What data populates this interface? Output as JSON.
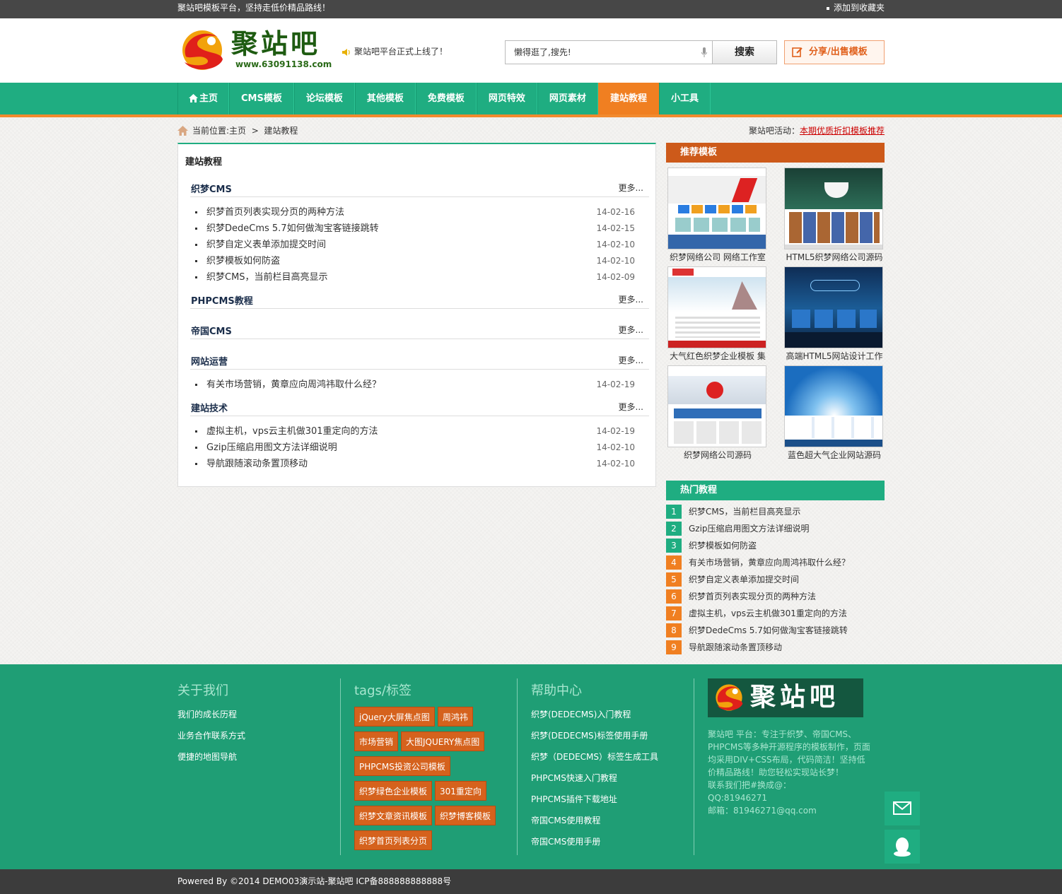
{
  "topbar": {
    "slogan": "聚站吧模板平台，坚持走低价精品路线！",
    "bookmark": "添加到收藏夹"
  },
  "header": {
    "logo_text": "聚站吧",
    "logo_url": "www.63091138.com",
    "notice": "聚站吧平台正式上线了！",
    "search_placeholder": "懒得逛了,搜先!",
    "search_button": "搜索",
    "share_button": "分享/出售模板"
  },
  "nav": [
    {
      "label": "主页",
      "active": false
    },
    {
      "label": "CMS模板",
      "active": false
    },
    {
      "label": "论坛模板",
      "active": false
    },
    {
      "label": "其他模板",
      "active": false
    },
    {
      "label": "免费模板",
      "active": false
    },
    {
      "label": "网页特效",
      "active": false
    },
    {
      "label": "网页素材",
      "active": false
    },
    {
      "label": "建站教程",
      "active": true
    },
    {
      "label": "小工具",
      "active": false
    }
  ],
  "breadcrumb": {
    "prefix": "当前位置:",
    "home": "主页",
    "sep": ">",
    "current": "建站教程",
    "activity_label": "聚站吧活动：",
    "activity_link": "本期优质折扣模板推荐"
  },
  "main": {
    "title": "建站教程",
    "more": "更多...",
    "categories": [
      {
        "name": "织梦CMS",
        "articles": [
          {
            "title": "织梦首页列表实现分页的两种方法",
            "date": "14-02-16"
          },
          {
            "title": "织梦DedeCms 5.7如何做淘宝客链接跳转",
            "date": "14-02-15"
          },
          {
            "title": "织梦自定义表单添加提交时间",
            "date": "14-02-10"
          },
          {
            "title": "织梦模板如何防盗",
            "date": "14-02-10"
          },
          {
            "title": "织梦CMS，当前栏目高亮显示",
            "date": "14-02-09"
          }
        ]
      },
      {
        "name": "PHPCMS教程",
        "articles": []
      },
      {
        "name": "帝国CMS",
        "articles": []
      },
      {
        "name": "网站运营",
        "articles": [
          {
            "title": "有关市场营销，黄章应向周鸿祎取什么经？",
            "date": "14-02-19"
          }
        ]
      },
      {
        "name": "建站技术",
        "articles": [
          {
            "title": "虚拟主机，vps云主机做301重定向的方法",
            "date": "14-02-19"
          },
          {
            "title": "Gzip压缩启用图文方法详细说明",
            "date": "14-02-10"
          },
          {
            "title": "导航跟随滚动条置顶移动",
            "date": "14-02-10"
          }
        ]
      }
    ]
  },
  "sidebar": {
    "recommend_title": "推荐模板",
    "templates": [
      {
        "caption": "织梦网络公司 网络工作室",
        "theme": "#e8eef7"
      },
      {
        "caption": "HTML5织梦网络公司源码",
        "theme": "#1c3a33"
      },
      {
        "caption": "大气红色织梦企业模板 集",
        "theme": "#dfeaf3"
      },
      {
        "caption": "高端HTML5网站设计工作",
        "theme": "#0f2d55"
      },
      {
        "caption": "织梦网络公司源码",
        "theme": "#2f6eb8"
      },
      {
        "caption": "蓝色超大气企业网站源码",
        "theme": "#1b6dbf"
      }
    ],
    "hot_title": "热门教程",
    "hot": [
      {
        "n": "1",
        "title": "织梦CMS，当前栏目高亮显示",
        "color": "g"
      },
      {
        "n": "2",
        "title": "Gzip压缩启用图文方法详细说明",
        "color": "g"
      },
      {
        "n": "3",
        "title": "织梦模板如何防盗",
        "color": "g"
      },
      {
        "n": "4",
        "title": "有关市场营销，黄章应向周鸿祎取什么经？",
        "color": "o"
      },
      {
        "n": "5",
        "title": "织梦自定义表单添加提交时间",
        "color": "o"
      },
      {
        "n": "6",
        "title": "织梦首页列表实现分页的两种方法",
        "color": "o"
      },
      {
        "n": "7",
        "title": "虚拟主机，vps云主机做301重定向的方法",
        "color": "o"
      },
      {
        "n": "8",
        "title": "织梦DedeCms 5.7如何做淘宝客链接跳转",
        "color": "o"
      },
      {
        "n": "9",
        "title": "导航跟随滚动条置顶移动",
        "color": "o"
      }
    ]
  },
  "footer": {
    "about_title": "关于我们",
    "about_links": [
      "我们的成长历程",
      "业务合作联系方式",
      "便捷的地图导航"
    ],
    "tags_title": "tags/标签",
    "tags": [
      "jQuery大屏焦点图",
      "周鸿祎",
      "市场营销",
      "大图JQUERY焦点图",
      "PHPCMS投资公司模板",
      "织梦绿色企业模板",
      "301重定向",
      "织梦文章资讯模板",
      "织梦博客模板",
      "织梦首页列表分页"
    ],
    "help_title": "帮助中心",
    "help_links": [
      "织梦(DEDECMS)入门教程",
      "织梦(DEDECMS)标签使用手册",
      "织梦（DEDECMS）标签生成工具",
      "PHPCMS快速入门教程",
      "PHPCMS插件下载地址",
      "帝国CMS使用教程",
      "帝国CMS使用手册"
    ],
    "logo_text": "聚站吧",
    "desc": "聚站吧 平台：专注于织梦、帝国CMS、PHPCMS等多种开源程序的模板制作，页面均采用DIV+CSS布局，代码简洁！坚持低价精品路线！助您轻松实现站长梦！",
    "contact": "联系我们把#换成@：",
    "qq": "QQ:81946271",
    "email": "邮箱：81946271@qq.com"
  },
  "bottom": {
    "copyright": "Powered By ©2014 DEMO03演示站-聚站吧 ICP备888888888888号"
  }
}
